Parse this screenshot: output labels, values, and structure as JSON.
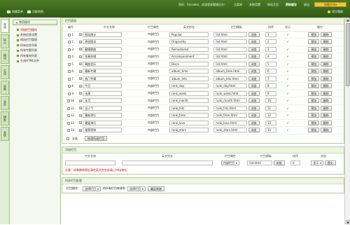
{
  "topbar": {
    "menu": [
      "隐藏菜单",
      "功能地图"
    ],
    "greeting": "您好：Xxcodex，欢迎登录管理后台！",
    "nav": [
      "主菜单",
      "系统设置",
      "网站主页",
      "更新缓存",
      "退出"
    ],
    "quick": "快捷方式",
    "help": "官方帮助"
  },
  "sidetabs": [
    "常用",
    "核心",
    "模块",
    "生成",
    "采集",
    "会员",
    "模板",
    "系统"
  ],
  "menu": {
    "title": "常用操作",
    "items": [
      {
        "label": "添加栏目操作",
        "red": true
      },
      {
        "label": "系统信息设置",
        "red": false
      },
      {
        "label": "网站栏目管理",
        "red": false
      },
      {
        "label": "所有信息列表",
        "red": false
      },
      {
        "label": "所有专题列表",
        "red": false
      },
      {
        "label": "所有查询列表",
        "red": false
      },
      {
        "label": "生成HTML文件",
        "red": false
      }
    ]
  },
  "columns": {
    "section_title": "栏目管理",
    "headers": [
      "编号",
      "中文名称",
      "栏目属性",
      "英文别名",
      "栏目模板",
      "排序",
      "显示",
      "操作"
    ],
    "rows": [
      {
        "id": "1",
        "cn": "网站统计",
        "attr": "内部栏目",
        "en": "Popular",
        "tpl": "list.html",
        "sort": "1"
      },
      {
        "id": "2",
        "cn": "原创版本",
        "attr": "内部栏目",
        "en": "Originality",
        "tpl": "list.html",
        "sort": "2"
      },
      {
        "id": "3",
        "cn": "翻唱歌曲",
        "attr": "内部栏目",
        "en": "Remastered",
        "tpl": "list.html",
        "sort": "3"
      },
      {
        "id": "4",
        "cn": "伴奏伴唱",
        "attr": "内部栏目",
        "en": "Accompaniment",
        "tpl": "list.html",
        "sort": "4"
      },
      {
        "id": "5",
        "cn": "舞曲音乐",
        "attr": "内部栏目",
        "en": "Disco",
        "tpl": "list.html",
        "sort": "5"
      },
      {
        "id": "6",
        "cn": "最新专辑",
        "attr": "内部栏目",
        "en": "album_time",
        "tpl": "album_time.html",
        "sort": "6"
      },
      {
        "id": "7",
        "cn": "热门专辑",
        "attr": "内部栏目",
        "en": "album_hits",
        "tpl": "album_hits.html",
        "sort": "7"
      },
      {
        "id": "8",
        "cn": "今日",
        "attr": "内部栏目",
        "en": "rank_day",
        "tpl": "rank_day.html",
        "sort": "8"
      },
      {
        "id": "9",
        "cn": "本周",
        "attr": "内部栏目",
        "en": "rank_week",
        "tpl": "rank_week.html",
        "sort": "9"
      },
      {
        "id": "10",
        "cn": "本月",
        "attr": "内部栏目",
        "en": "rank_month",
        "tpl": "rank_month.html",
        "sort": "10"
      },
      {
        "id": "11",
        "cn": "总人气",
        "attr": "内部栏目",
        "en": "rank_hits",
        "tpl": "rank_hits.html",
        "sort": "11"
      },
      {
        "id": "12",
        "cn": "最新排行",
        "attr": "内部栏目",
        "en": "rank_time",
        "tpl": "rank_time.html",
        "sort": "12"
      },
      {
        "id": "13",
        "cn": "最爱排行",
        "attr": "内部栏目",
        "en": "rank_love",
        "tpl": "rank_love.html",
        "sort": "13"
      },
      {
        "id": "14",
        "cn": "推荐榜单",
        "attr": "内部栏目",
        "en": "rank_stars",
        "tpl": "rank_stars.html",
        "sort": "14"
      }
    ],
    "browse": "浏览",
    "preview": "预览",
    "delete": "删除",
    "select_all": "全选",
    "save_btn": "修改所选栏目"
  },
  "add": {
    "section_title": "添加栏目",
    "headers": [
      "中文名称",
      "英文别名",
      "栏目属性",
      "栏目模板",
      "排序",
      "状态"
    ],
    "attr": "内部栏目",
    "tpl": "list.html",
    "sort": "0",
    "status": "显示",
    "btn": "提交",
    "browse": "浏览",
    "tip": "注意：如果跳转网址请在英文别名处填上http地址"
  },
  "bottom": {
    "section_title": "所选栏目批量",
    "label": "栏目操作：",
    "select1": "选择栏目",
    "select2": "的所有栏目转移到",
    "select3": "选择栏目",
    "btn": "确定转移"
  }
}
